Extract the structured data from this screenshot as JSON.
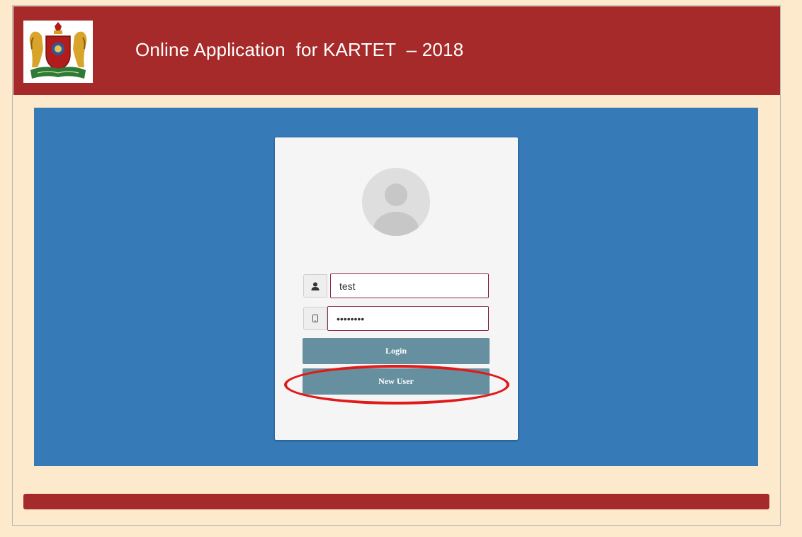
{
  "header": {
    "title": "Online Application  for KARTET  – 2018",
    "logo_icon": "karnataka-emblem-icon"
  },
  "login": {
    "avatar_icon": "user-avatar-icon",
    "username_icon": "user-icon",
    "username_value": "test",
    "password_icon": "mobile-icon",
    "password_value": "12345678",
    "login_label": "Login",
    "new_user_label": "New User"
  },
  "annotation": {
    "highlight_color": "#e01919",
    "highlight_target": "New User"
  },
  "colors": {
    "background": "#fdeacc",
    "header": "#a62a2a",
    "panel": "#367ab8",
    "button": "#66909f",
    "field_border": "#8b2c4b"
  }
}
